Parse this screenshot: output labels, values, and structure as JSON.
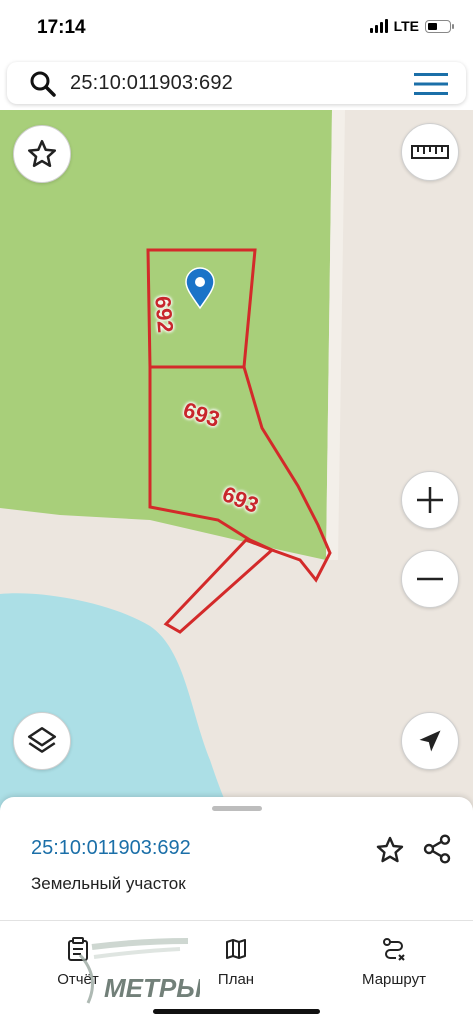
{
  "status_bar": {
    "time": "17:14",
    "network": "LTE"
  },
  "search": {
    "value": "25:10:011903:692"
  },
  "map": {
    "parcel_labels": [
      "692",
      "693",
      "693"
    ],
    "colors": {
      "forest": "#a8cf7a",
      "land": "#ece6df",
      "water": "#acdfe6",
      "parcel_border": "#d32a2a",
      "marker": "#1a73c8"
    }
  },
  "map_controls": {
    "favorite": "star-icon",
    "ruler": "ruler-icon",
    "zoom_in": "plus-icon",
    "zoom_out": "minus-icon",
    "layers": "layers-icon",
    "locate": "navigation-arrow-icon"
  },
  "info_sheet": {
    "title": "25:10:011903:692",
    "subtitle": "Земельный участок"
  },
  "bottom_nav": {
    "items": [
      {
        "label": "Отчёт",
        "icon": "clipboard-icon"
      },
      {
        "label": "План",
        "icon": "map-icon"
      },
      {
        "label": "Маршрут",
        "icon": "route-icon"
      }
    ]
  },
  "watermark": {
    "text": "МЕТРЫ"
  },
  "accent_color": "#1b6fa8"
}
